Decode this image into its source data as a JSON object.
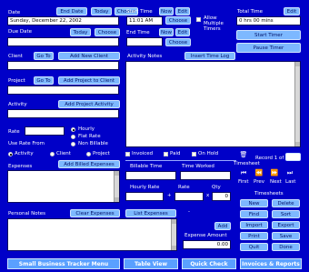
{
  "date": {
    "label": "Date",
    "end_date_btn": "End Date",
    "today_btn": "Today",
    "choose_btn": "Choose",
    "value": "Sunday, December 22, 2002"
  },
  "due_date": {
    "label": "Due Date",
    "today_btn": "Today",
    "choose_btn": "Choose"
  },
  "start_time": {
    "label": "Start Time",
    "now_btn": "Now",
    "edit_btn": "Edit",
    "value": "11:01 AM",
    "choose_btn": "Choose"
  },
  "allow_multiple": {
    "label": "Allow Multiple Timers"
  },
  "total_time": {
    "label": "Total Time",
    "edit_btn": "Edit",
    "value": "0 hrs 00 mins"
  },
  "end_time": {
    "label": "End Time",
    "now_btn": "Now",
    "edit_btn": "Edit",
    "choose_btn": "Choose"
  },
  "timer_buttons": {
    "start": "Start Timer",
    "pause": "Pause Timer"
  },
  "client": {
    "label": "Client",
    "goto_btn": "Go To",
    "add_btn": "Add New Client"
  },
  "project": {
    "label": "Project",
    "goto_btn": "Go To",
    "add_btn": "Add Project to Client"
  },
  "activity": {
    "label": "Activity",
    "add_btn": "Add Project Activity"
  },
  "activity_notes": {
    "label": "Activity Notes",
    "insert_btn": "Insert Time Log"
  },
  "rate": {
    "label": "Rate",
    "opt_hourly": "Hourly",
    "opt_flat": "Flat Rate",
    "opt_non": "Non Billable"
  },
  "use_rate_from": {
    "label": "Use Rate From",
    "opt_activity": "Activity",
    "opt_client": "Client",
    "opt_project": "Project"
  },
  "invoice": {
    "invoiced": "Invoiced",
    "paid": "Paid",
    "on_hold": "On Hold"
  },
  "expenses": {
    "label": "Expenses",
    "add_btn": "Add Billed Expenses",
    "personal_label": "Personal Notes",
    "clear_btn": "Clear Expenses",
    "list_btn": "List Expenses"
  },
  "calc": {
    "billable_time": "Billable Time",
    "time_worked": "Time Worked",
    "hourly_rate": "Hourly Rate",
    "rate": "Rate",
    "qty": "Qty",
    "qty_value": "0",
    "amount_value": "0.00",
    "plus": "+",
    "minus": "-",
    "add_btn": "Add",
    "expense_amount": "Expense Amount"
  },
  "nav": {
    "timesheet_label": "Timesheet",
    "record_label": "Record 1 of 1",
    "first": "First",
    "prev": "Prev",
    "next": "Next",
    "last": "Last"
  },
  "timesheets": {
    "label": "Timesheets",
    "new": "New",
    "delete": "Delete",
    "find": "Find",
    "sort": "Sort",
    "import": "Import",
    "export": "Export",
    "print": "Print",
    "save": "Save",
    "quit": "Quit",
    "done": "Done"
  },
  "bottom": {
    "menu_btn": "Small Business Tracker Menu",
    "table_btn": "Table View",
    "quick_btn": "Quick Check",
    "invoices_btn": "Invoices & Reports"
  }
}
